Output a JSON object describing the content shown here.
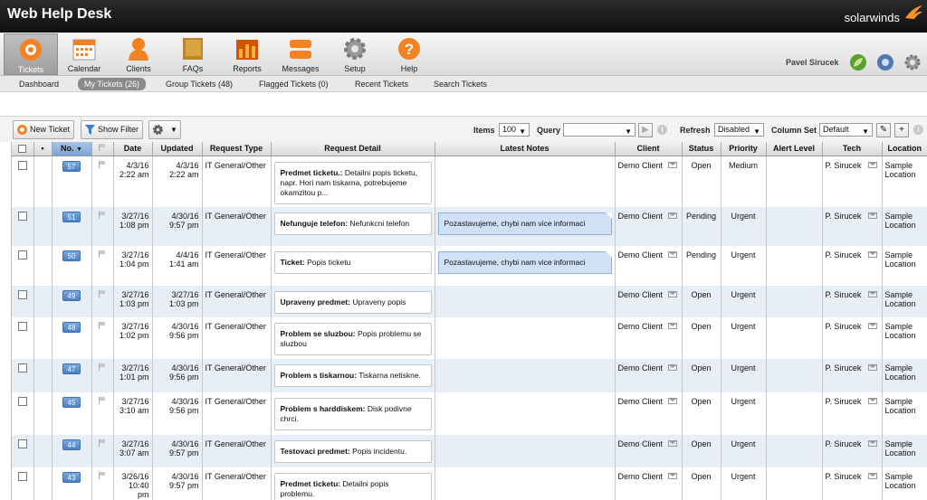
{
  "app": {
    "title": "Web Help Desk",
    "brand": "solarwinds"
  },
  "nav": [
    {
      "label": "Tickets",
      "icon": "lifebuoy-icon",
      "active": true
    },
    {
      "label": "Calendar",
      "icon": "calendar-icon"
    },
    {
      "label": "Clients",
      "icon": "person-icon"
    },
    {
      "label": "FAQs",
      "icon": "book-icon"
    },
    {
      "label": "Reports",
      "icon": "reports-icon"
    },
    {
      "label": "Messages",
      "icon": "messages-icon"
    },
    {
      "label": "Setup",
      "icon": "gear-icon"
    },
    {
      "label": "Help",
      "icon": "help-icon"
    }
  ],
  "user": {
    "name": "Pavel Sirucek"
  },
  "subnav": [
    {
      "label": "Dashboard"
    },
    {
      "label": "My Tickets (26)",
      "active": true
    },
    {
      "label": "Group Tickets (48)"
    },
    {
      "label": "Flagged Tickets (0)"
    },
    {
      "label": "Recent Tickets"
    },
    {
      "label": "Search Tickets"
    }
  ],
  "toolbar": {
    "new_ticket": "New Ticket",
    "show_filter": "Show Filter",
    "items_label": "Items",
    "items_value": "100",
    "query_label": "Query",
    "query_value": "",
    "refresh_label": "Refresh",
    "refresh_value": "Disabled",
    "column_set_label": "Column Set",
    "column_set_value": "Default"
  },
  "columns": {
    "no": "No.",
    "date": "Date",
    "updated": "Updated",
    "request_type": "Request Type",
    "request_detail": "Request Detail",
    "latest_notes": "Latest Notes",
    "client": "Client",
    "status": "Status",
    "priority": "Priority",
    "alert_level": "Alert Level",
    "tech": "Tech",
    "location": "Location"
  },
  "tickets": [
    {
      "no": "57",
      "date1": "4/3/16",
      "date2": "2:22 am",
      "upd1": "4/3/16",
      "upd2": "2:22 am",
      "type": "IT General/Other",
      "subject": "Predmet ticketu.:",
      "detail": " Detailni popis ticketu, napr. Hori nam tiskarna, potrebujeme okamzitou p...",
      "note": "",
      "client": "Demo Client",
      "status": "Open",
      "priority": "Medium",
      "alert": "",
      "tech": "P. Sirucek",
      "loc1": "Sample",
      "loc2": "Location"
    },
    {
      "no": "51",
      "date1": "3/27/16",
      "date2": "1:08 pm",
      "upd1": "4/30/16",
      "upd2": "9:57 pm",
      "type": "IT General/Other",
      "subject": "Nefunguje telefon:",
      "detail": " Nefunkcni telefon",
      "note": "Pozastavujeme, chybi nam vice informaci",
      "client": "Demo Client",
      "status": "Pending",
      "priority": "Urgent",
      "alert": "",
      "tech": "P. Sirucek",
      "loc1": "Sample",
      "loc2": "Location"
    },
    {
      "no": "50",
      "date1": "3/27/16",
      "date2": "1:04 pm",
      "upd1": "4/4/16",
      "upd2": "1:41 am",
      "type": "IT General/Other",
      "subject": "Ticket:",
      "detail": " Popis ticketu",
      "note": "Pozastavujeme, chybi nam vice informaci",
      "client": "Demo Client",
      "status": "Pending",
      "priority": "Urgent",
      "alert": "",
      "tech": "P. Sirucek",
      "loc1": "Sample",
      "loc2": "Location"
    },
    {
      "no": "49",
      "date1": "3/27/16",
      "date2": "1:03 pm",
      "upd1": "3/27/16",
      "upd2": "1:03 pm",
      "type": "IT General/Other",
      "subject": "Upraveny predmet:",
      "detail": " Upraveny popis",
      "note": "",
      "client": "Demo Client",
      "status": "Open",
      "priority": "Urgent",
      "alert": "",
      "tech": "P. Sirucek",
      "loc1": "Sample",
      "loc2": "Location"
    },
    {
      "no": "48",
      "date1": "3/27/16",
      "date2": "1:02 pm",
      "upd1": "4/30/16",
      "upd2": "9:56 pm",
      "type": "IT General/Other",
      "subject": "Problem se sluzbou:",
      "detail": " Popis problemu se sluzbou",
      "note": "",
      "client": "Demo Client",
      "status": "Open",
      "priority": "Urgent",
      "alert": "",
      "tech": "P. Sirucek",
      "loc1": "Sample",
      "loc2": "Location"
    },
    {
      "no": "47",
      "date1": "3/27/16",
      "date2": "1:01 pm",
      "upd1": "4/30/16",
      "upd2": "9:56 pm",
      "type": "IT General/Other",
      "subject": "Problem s tiskarnou:",
      "detail": " Tiskarna netiskne.",
      "note": "",
      "client": "Demo Client",
      "status": "Open",
      "priority": "Urgent",
      "alert": "",
      "tech": "P. Sirucek",
      "loc1": "Sample",
      "loc2": "Location"
    },
    {
      "no": "45",
      "date1": "3/27/16",
      "date2": "3:10 am",
      "upd1": "4/30/16",
      "upd2": "9:56 pm",
      "type": "IT General/Other",
      "subject": "Problem s harddiskem:",
      "detail": " Disk podivne chrci.",
      "note": "",
      "client": "Demo Client",
      "status": "Open",
      "priority": "Urgent",
      "alert": "",
      "tech": "P. Sirucek",
      "loc1": "Sample",
      "loc2": "Location"
    },
    {
      "no": "44",
      "date1": "3/27/16",
      "date2": "3:07 am",
      "upd1": "4/30/16",
      "upd2": "9:57 pm",
      "type": "IT General/Other",
      "subject": "Testovaci predmet:",
      "detail": " Popis incidentu.",
      "note": "",
      "client": "Demo Client",
      "status": "Open",
      "priority": "Urgent",
      "alert": "",
      "tech": "P. Sirucek",
      "loc1": "Sample",
      "loc2": "Location"
    },
    {
      "no": "43",
      "date1": "3/26/16",
      "date2": "10:40 pm",
      "upd1": "4/30/16",
      "upd2": "9:57 pm",
      "type": "IT General/Other",
      "subject": "Predmet ticketu:",
      "detail": " Detailni popis problemu.",
      "note": "",
      "client": "Demo Client",
      "status": "Open",
      "priority": "Urgent",
      "alert": "",
      "tech": "P. Sirucek",
      "loc1": "Sample",
      "loc2": "Location"
    }
  ]
}
